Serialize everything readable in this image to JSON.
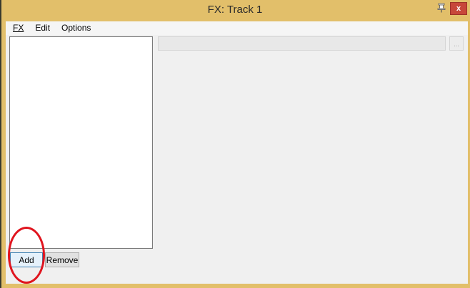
{
  "window": {
    "title": "FX: Track 1",
    "close_label": "x"
  },
  "menubar": {
    "items": [
      {
        "label": "FX"
      },
      {
        "label": "Edit"
      },
      {
        "label": "Options"
      }
    ]
  },
  "plugin": {
    "browse_label": "..."
  },
  "buttons": {
    "add_label": "Add",
    "remove_label": "Remove"
  },
  "colors": {
    "frame": "#e2bf6a",
    "close": "#c7473a",
    "annotation": "#e0141e"
  },
  "icons": {
    "pin": "pin-icon",
    "close": "close-icon"
  }
}
